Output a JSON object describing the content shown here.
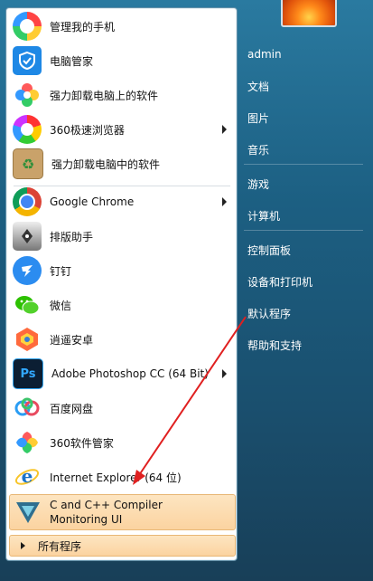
{
  "start_menu": {
    "programs": [
      {
        "label": "管理我的手机",
        "icon": "phone-manager-icon",
        "submenu": false
      },
      {
        "label": "电脑管家",
        "icon": "pc-manager-shield-icon",
        "submenu": false
      },
      {
        "label": "强力卸载电脑上的软件",
        "icon": "uninstall-flower-icon",
        "submenu": false
      },
      {
        "label": "360极速浏览器",
        "icon": "browser-360-icon",
        "submenu": true
      },
      {
        "label": "强力卸载电脑中的软件",
        "icon": "recycle-box-icon",
        "submenu": false
      },
      {
        "label": "Google Chrome",
        "icon": "chrome-icon",
        "submenu": true
      },
      {
        "label": "排版助手",
        "icon": "pen-nib-icon",
        "submenu": false
      },
      {
        "label": "钉钉",
        "icon": "dingtalk-icon",
        "submenu": false
      },
      {
        "label": "微信",
        "icon": "wechat-icon",
        "submenu": false
      },
      {
        "label": "逍遥安卓",
        "icon": "android-emulator-icon",
        "submenu": false
      },
      {
        "label": "Adobe Photoshop CC (64 Bit)",
        "icon": "photoshop-icon",
        "submenu": true
      },
      {
        "label": "百度网盘",
        "icon": "baidu-cloud-icon",
        "submenu": false
      },
      {
        "label": "360软件管家",
        "icon": "software-manager-icon",
        "submenu": false
      },
      {
        "label": "Internet Explorer (64 位)",
        "icon": "ie-icon",
        "submenu": false
      }
    ],
    "highlighted": {
      "line1": "C and C++ Compiler",
      "line2": "Monitoring UI"
    },
    "all_programs": "所有程序",
    "right_links": [
      "admin",
      "文档",
      "图片",
      "音乐",
      "游戏",
      "计算机",
      "控制面板",
      "设备和打印机",
      "默认程序",
      "帮助和支持"
    ]
  },
  "colors": {
    "annotation_arrow": "#e02020",
    "highlight_bg": "#fbd3a0"
  }
}
